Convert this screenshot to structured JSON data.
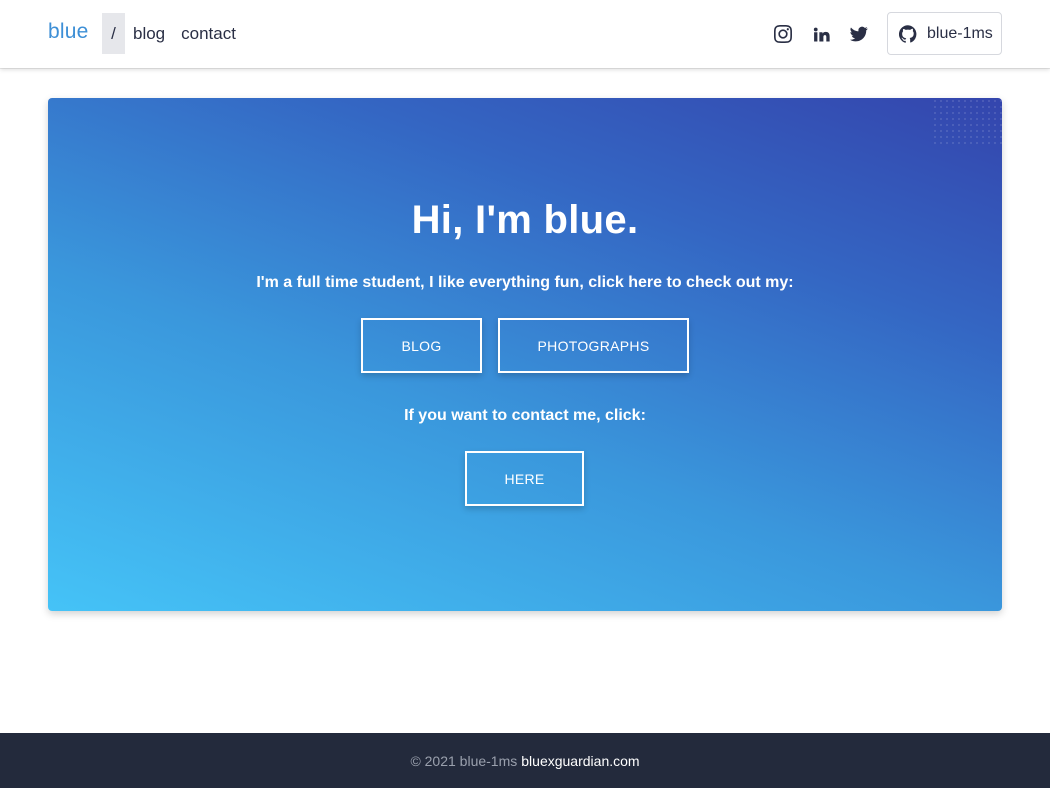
{
  "navbar": {
    "brand": "blue",
    "links": [
      {
        "label": "/",
        "active": true
      },
      {
        "label": "blog",
        "active": false
      },
      {
        "label": "contact",
        "active": false
      }
    ],
    "social": [
      {
        "icon": "instagram-icon"
      },
      {
        "icon": "linkedin-icon"
      },
      {
        "icon": "twitter-icon"
      }
    ],
    "github": {
      "icon": "github-icon",
      "label": "blue-1ms"
    }
  },
  "hero": {
    "title": "Hi, I'm blue.",
    "subtitle": "I'm a full time student, I like everything fun, click here to check out my:",
    "buttons": [
      {
        "label": "BLOG"
      },
      {
        "label": "PHOTOGRAPHS"
      }
    ],
    "contact_text": "If you want to contact me, click:",
    "contact_button": "HERE"
  },
  "footer": {
    "copyright": "© 2021 blue-1ms",
    "link": "bluexguardian.com"
  },
  "colors": {
    "accent": "#3d8fd6",
    "footer_bg": "#232a3c",
    "gradient_start": "#45c3f7",
    "gradient_end": "#3445ad"
  }
}
